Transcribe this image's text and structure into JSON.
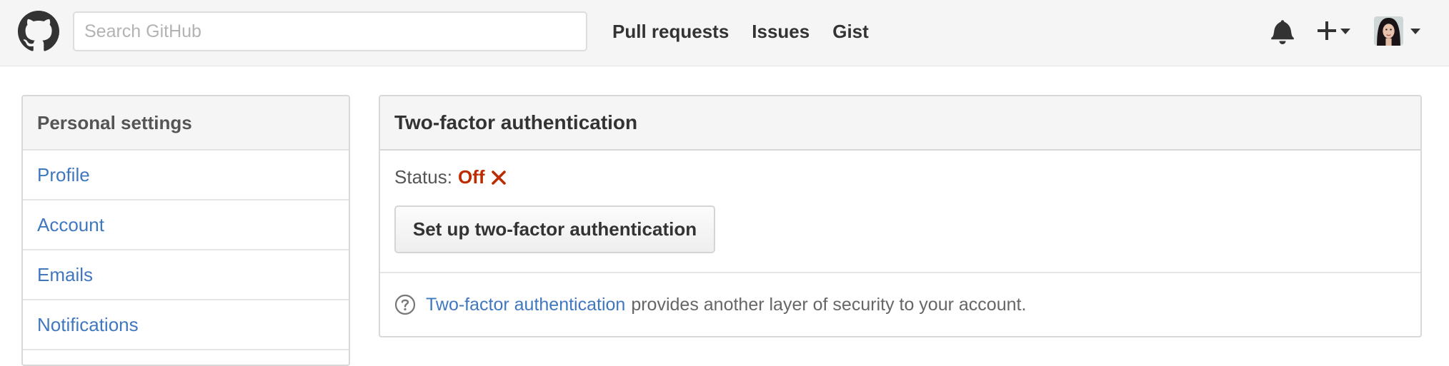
{
  "header": {
    "logo_icon": "github-octocat-icon",
    "search": {
      "placeholder": "Search GitHub",
      "value": ""
    },
    "nav": [
      {
        "label": "Pull requests"
      },
      {
        "label": "Issues"
      },
      {
        "label": "Gist"
      }
    ],
    "right_icons": [
      "bell-icon",
      "plus-icon",
      "avatar"
    ]
  },
  "sidebar": {
    "title": "Personal settings",
    "items": [
      {
        "label": "Profile"
      },
      {
        "label": "Account"
      },
      {
        "label": "Emails"
      },
      {
        "label": "Notifications"
      }
    ]
  },
  "panel": {
    "title": "Two-factor authentication",
    "status_label": "Status:",
    "status_value": "Off",
    "status_icon": "x-icon",
    "setup_button": "Set up two-factor authentication",
    "help_link": "Two-factor authentication",
    "help_text": "provides another layer of security to your account."
  },
  "colors": {
    "link": "#4078c0",
    "status_off": "#bd2c00",
    "header_bg": "#f5f5f5"
  }
}
